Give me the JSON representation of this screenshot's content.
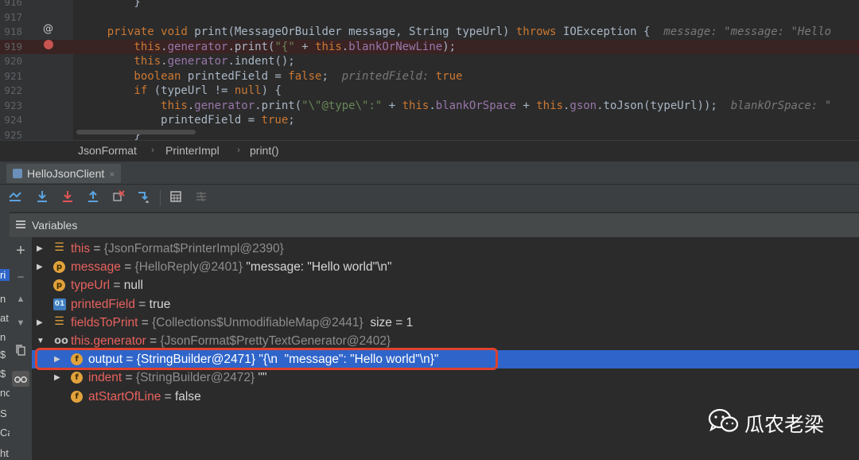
{
  "editor": {
    "lines": [
      {
        "num": "916",
        "parts": [
          [
            "",
            "        }"
          ]
        ]
      },
      {
        "num": "917",
        "parts": []
      },
      {
        "num": "918",
        "parts": [
          [
            "kw",
            "    private void "
          ],
          [
            "",
            "print(MessageOrBuilder message, String typeUrl) "
          ],
          [
            "kw",
            "throws "
          ],
          [
            "",
            "IOException {  "
          ],
          [
            "hint",
            "message: \"message: \"Hello"
          ]
        ]
      },
      {
        "num": "919",
        "parts": [
          [
            "kw",
            "        this"
          ],
          [
            "",
            "."
          ],
          [
            "fld",
            "generator"
          ],
          [
            "",
            ".print("
          ],
          [
            "str",
            "\"{\""
          ],
          [
            "",
            " + "
          ],
          [
            "kw",
            "this"
          ],
          [
            "",
            "."
          ],
          [
            "fld",
            "blankOrNewLine"
          ],
          [
            "",
            ");"
          ]
        ]
      },
      {
        "num": "920",
        "parts": [
          [
            "kw",
            "        this"
          ],
          [
            "",
            "."
          ],
          [
            "fld",
            "generator"
          ],
          [
            "",
            ".indent();"
          ]
        ]
      },
      {
        "num": "921",
        "parts": [
          [
            "kw",
            "        boolean "
          ],
          [
            "",
            "printedField = "
          ],
          [
            "kw",
            "false"
          ],
          [
            "",
            ";  "
          ],
          [
            "hint",
            "printedField: "
          ],
          [
            "kw",
            "true"
          ]
        ]
      },
      {
        "num": "922",
        "parts": [
          [
            "kw",
            "        if "
          ],
          [
            "",
            "(typeUrl != "
          ],
          [
            "kw",
            "null"
          ],
          [
            "",
            ") {"
          ]
        ]
      },
      {
        "num": "923",
        "parts": [
          [
            "kw",
            "            this"
          ],
          [
            "",
            "."
          ],
          [
            "fld",
            "generator"
          ],
          [
            "",
            ".print("
          ],
          [
            "str",
            "\"\\\"@type\\\":\""
          ],
          [
            "",
            " + "
          ],
          [
            "kw",
            "this"
          ],
          [
            "",
            "."
          ],
          [
            "fld",
            "blankOrSpace"
          ],
          [
            "",
            " + "
          ],
          [
            "kw",
            "this"
          ],
          [
            "",
            "."
          ],
          [
            "fld",
            "gson"
          ],
          [
            "",
            ".toJson(typeUrl));  "
          ],
          [
            "hint",
            "blankOrSpace: \""
          ]
        ]
      },
      {
        "num": "924",
        "parts": [
          [
            "",
            "            printedField = "
          ],
          [
            "kw",
            "true"
          ],
          [
            "",
            ";"
          ]
        ]
      },
      {
        "num": "925",
        "parts": [
          [
            "",
            "        }"
          ]
        ]
      }
    ],
    "gutter_mark_at": "@"
  },
  "breadcrumb": {
    "items": [
      "JsonFormat",
      "PrinterImpl",
      "print()"
    ],
    "separator": "›"
  },
  "run_tab": {
    "label": "HelloJsonClient",
    "close": "×"
  },
  "variables_panel": {
    "title": "Variables",
    "rows": [
      {
        "indent": 0,
        "arrow": "▶",
        "badge": "list",
        "badge_text": "☰",
        "name": "this",
        "op": " = ",
        "obj": "{JsonFormat$PrinterImpl@2390}",
        "value": ""
      },
      {
        "indent": 0,
        "arrow": "▶",
        "badge": "p",
        "badge_text": "p",
        "name": "message",
        "op": " = ",
        "obj": "{HelloReply@2401}",
        "value": " \"message: \"Hello world\"\\n\""
      },
      {
        "indent": 0,
        "arrow": "",
        "badge": "p",
        "badge_text": "p",
        "name": "typeUrl",
        "op": " = ",
        "obj": "",
        "value": "null"
      },
      {
        "indent": 0,
        "arrow": "",
        "badge": "01",
        "badge_text": "01",
        "name": "printedField",
        "op": " = ",
        "obj": "",
        "value": "true"
      },
      {
        "indent": 0,
        "arrow": "▶",
        "badge": "list",
        "badge_text": "☰",
        "name": "fieldsToPrint",
        "op": " = ",
        "obj": "{Collections$UnmodifiableMap@2441}",
        "value": "  size = 1"
      },
      {
        "indent": 0,
        "arrow": "▼",
        "badge": "oo",
        "badge_text": "oo",
        "name": "this.generator",
        "op": " = ",
        "obj": "{JsonFormat$PrettyTextGenerator@2402}",
        "value": ""
      },
      {
        "indent": 1,
        "arrow": "▶",
        "badge": "f",
        "badge_text": "f",
        "name": "output",
        "op": " = ",
        "obj": "{StringBuilder@2471}",
        "value": " \"{\\n  \"message\": \"Hello world\"\\n}\"",
        "selected": true
      },
      {
        "indent": 1,
        "arrow": "▶",
        "badge": "f",
        "badge_text": "f",
        "name": "indent",
        "op": " = ",
        "obj": "{StringBuilder@2472}",
        "value": " \"\""
      },
      {
        "indent": 1,
        "arrow": "",
        "badge": "f",
        "badge_text": "f",
        "name": "atStartOfLine",
        "op": " = ",
        "obj": "",
        "value": "false"
      }
    ]
  },
  "left_strip": [
    "ri",
    "n",
    "at",
    "n",
    "$",
    "$",
    "nc",
    "S",
    "Ca",
    "ht"
  ],
  "watermark": {
    "text": "瓜农老梁"
  },
  "colors": {
    "editor_bg": "#2b2b2b",
    "selection": "#2f65ca",
    "highlight_box": "#e0412e",
    "keyword": "#cc7832",
    "var_name": "#e8625f"
  }
}
